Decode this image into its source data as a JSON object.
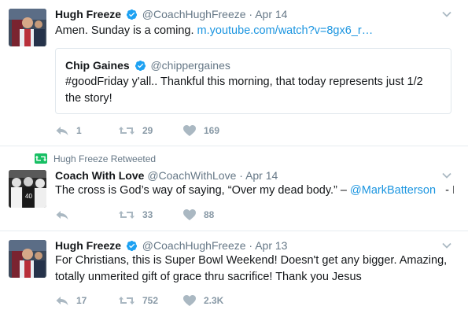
{
  "tweets": [
    {
      "author_name": "Hugh Freeze",
      "handle": "@CoachHughFreeze",
      "separator": "·",
      "date": "Apr 14",
      "text": "Amen. Sunday is a coming. ",
      "link": "m.youtube.com/watch?v=8gx6_r…",
      "quoted": {
        "author_name": "Chip Gaines",
        "handle": "@chippergaines",
        "text": "#goodFriday y'all.. Thankful this morning, that today represents just 1/2 the story!"
      },
      "reply_count": "1",
      "retweet_count": "29",
      "like_count": "169"
    },
    {
      "context": "Hugh Freeze Retweeted",
      "author_name": "Coach With Love",
      "handle": "@CoachWithLove",
      "separator": "·",
      "date": "Apr 14",
      "text": "The cross is God’s way of saying, “Over my dead body.” – ",
      "mention": "@MarkBatterson",
      "text_tail": "   - If",
      "reply_count": "",
      "retweet_count": "33",
      "like_count": "88"
    },
    {
      "author_name": "Hugh Freeze",
      "handle": "@CoachHughFreeze",
      "separator": "·",
      "date": "Apr 13",
      "text": "For Christians, this is Super Bowl Weekend! Doesn't get any bigger. Amazing, totally unmerited gift of grace thru sacrifice! Thank you Jesus",
      "reply_count": "17",
      "retweet_count": "752",
      "like_count": "2.3K"
    }
  ],
  "icons": {
    "verified": "verified-badge-icon",
    "caret": "chevron-down-icon",
    "reply": "reply-icon",
    "retweet": "retweet-icon",
    "like": "heart-icon"
  },
  "colors": {
    "link": "#1b95e0",
    "verified": "#1da1f2",
    "retweet_context": "#17bf63",
    "action_gray": "#8899a6"
  }
}
